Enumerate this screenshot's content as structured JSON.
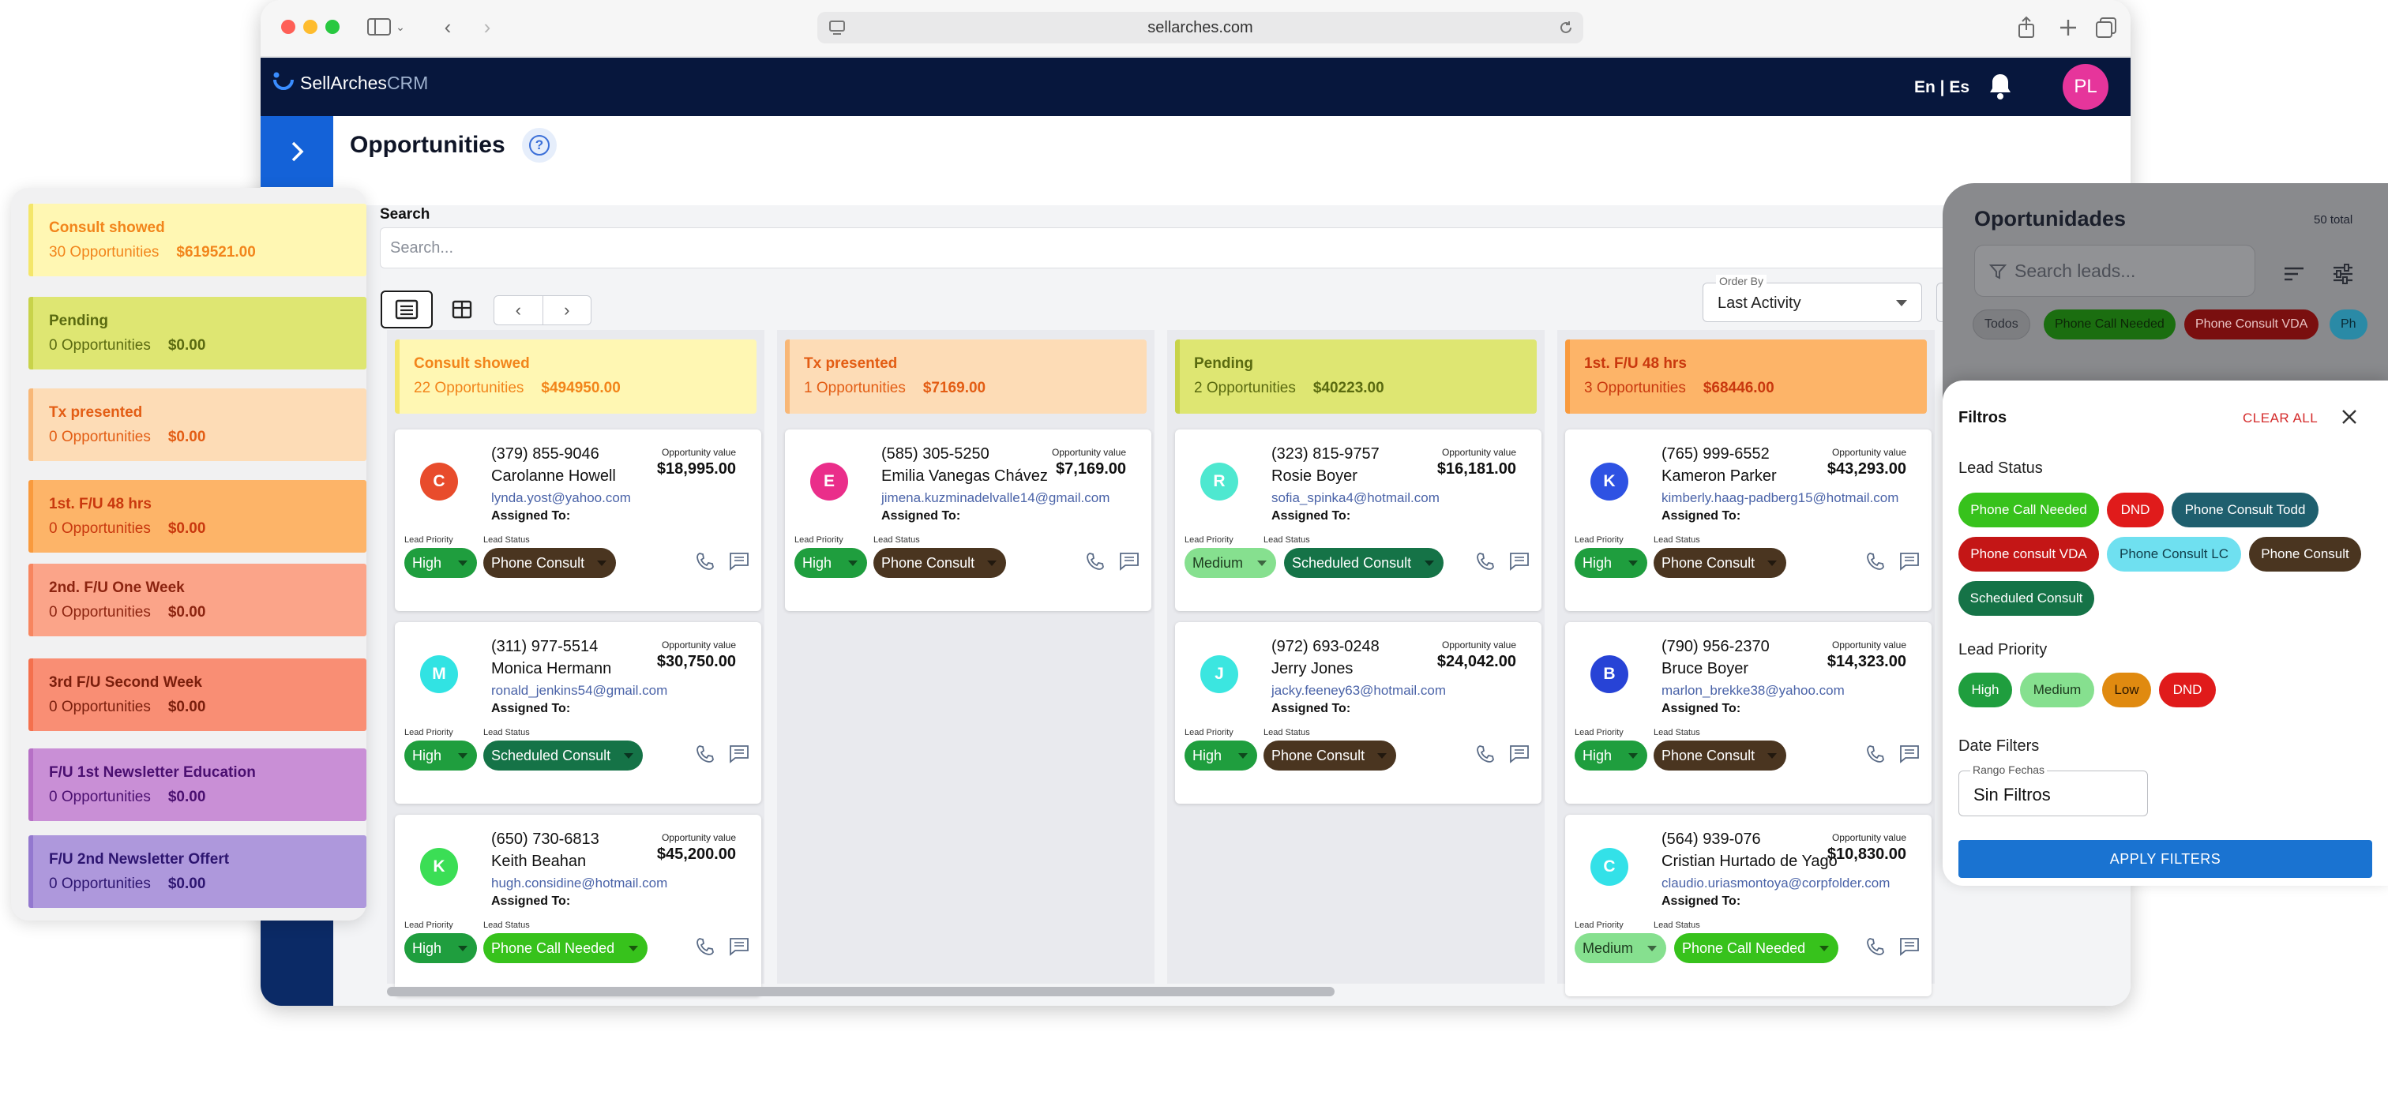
{
  "browser": {
    "url": "sellarches.com"
  },
  "app": {
    "brand": "SellArches",
    "brand_suffix": "CRM",
    "language": "En | Es",
    "avatar_initials": "PL",
    "page_title": "Opportunities"
  },
  "search": {
    "label": "Search",
    "placeholder": "Search..."
  },
  "order_by": {
    "label": "Order By",
    "value": "Last Activity"
  },
  "columns": [
    {
      "title": "Consult showed",
      "count": "22 Opportunities",
      "amount": "$494950.00",
      "cards": [
        {
          "initial": "C",
          "phone": "(379) 855-9046",
          "name": "Carolanne Howell",
          "email": "lynda.yost@yahoo.com",
          "assigned": "Assigned To:",
          "value_label": "Opportunity value",
          "value": "$18,995.00",
          "lp_label": "Lead Priority",
          "ls_label": "Lead Status",
          "priority": "High",
          "status": "Phone Consult"
        },
        {
          "initial": "M",
          "phone": "(311) 977-5514",
          "name": "Monica Hermann",
          "email": "ronald_jenkins54@gmail.com",
          "assigned": "Assigned To:",
          "value_label": "Opportunity value",
          "value": "$30,750.00",
          "lp_label": "Lead Priority",
          "ls_label": "Lead Status",
          "priority": "High",
          "status": "Scheduled Consult"
        },
        {
          "initial": "K",
          "phone": "(650) 730-6813",
          "name": "Keith Beahan",
          "email": "hugh.considine@hotmail.com",
          "assigned": "Assigned To:",
          "value_label": "Opportunity value",
          "value": "$45,200.00",
          "lp_label": "Lead Priority",
          "ls_label": "Lead Status",
          "priority": "High",
          "status": "Phone Call Needed"
        }
      ]
    },
    {
      "title": "Tx presented",
      "count": "1 Opportunities",
      "amount": "$7169.00",
      "cards": [
        {
          "initial": "E",
          "phone": "(585) 305-5250",
          "name": "Emilia Vanegas Chávez",
          "email": "jimena.kuzminadelvalle14@gmail.com",
          "assigned": "Assigned To:",
          "value_label": "Opportunity value",
          "value": "$7,169.00",
          "lp_label": "Lead Priority",
          "ls_label": "Lead Status",
          "priority": "High",
          "status": "Phone Consult"
        }
      ]
    },
    {
      "title": "Pending",
      "count": "2 Opportunities",
      "amount": "$40223.00",
      "cards": [
        {
          "initial": "R",
          "phone": "(323) 815-9757",
          "name": "Rosie Boyer",
          "email": "sofia_spinka4@hotmail.com",
          "assigned": "Assigned To:",
          "value_label": "Opportunity value",
          "value": "$16,181.00",
          "lp_label": "Lead Priority",
          "ls_label": "Lead Status",
          "priority": "Medium",
          "status": "Scheduled Consult"
        },
        {
          "initial": "J",
          "phone": "(972) 693-0248",
          "name": "Jerry Jones",
          "email": "jacky.feeney63@hotmail.com",
          "assigned": "Assigned To:",
          "value_label": "Opportunity value",
          "value": "$24,042.00",
          "lp_label": "Lead Priority",
          "ls_label": "Lead Status",
          "priority": "High",
          "status": "Phone Consult"
        }
      ]
    },
    {
      "title": "1st. F/U 48 hrs",
      "count": "3 Opportunities",
      "amount": "$68446.00",
      "cards": [
        {
          "initial": "K",
          "phone": "(765) 999-6552",
          "name": "Kameron Parker",
          "email": "kimberly.haag-padberg15@hotmail.com",
          "assigned": "Assigned To:",
          "value_label": "Opportunity value",
          "value": "$43,293.00",
          "lp_label": "Lead Priority",
          "ls_label": "Lead Status",
          "priority": "High",
          "status": "Phone Consult"
        },
        {
          "initial": "B",
          "phone": "(790) 956-2370",
          "name": "Bruce Boyer",
          "email": "marlon_brekke38@yahoo.com",
          "assigned": "Assigned To:",
          "value_label": "Opportunity value",
          "value": "$14,323.00",
          "lp_label": "Lead Priority",
          "ls_label": "Lead Status",
          "priority": "High",
          "status": "Phone Consult"
        },
        {
          "initial": "C",
          "phone": "(564) 939-076",
          "name": "Cristian Hurtado de Yago",
          "email": "claudio.uriasmontoya@corpfolder.com",
          "assigned": "Assigned To:",
          "value_label": "Opportunity value",
          "value": "$10,830.00",
          "lp_label": "Lead Priority",
          "ls_label": "Lead Status",
          "priority": "Medium",
          "status": "Phone Call Needed"
        }
      ]
    }
  ],
  "left_list": [
    {
      "title": "Consult showed",
      "count": "30 Opportunities",
      "amount": "$619521.00"
    },
    {
      "title": "Pending",
      "count": "0 Opportunities",
      "amount": "$0.00"
    },
    {
      "title": "Tx presented",
      "count": "0 Opportunities",
      "amount": "$0.00"
    },
    {
      "title": "1st. F/U 48 hrs",
      "count": "0 Opportunities",
      "amount": "$0.00"
    },
    {
      "title": "2nd. F/U One Week",
      "count": "0 Opportunities",
      "amount": "$0.00"
    },
    {
      "title": "3rd F/U Second Week",
      "count": "0 Opportunities",
      "amount": "$0.00"
    },
    {
      "title": "F/U 1st Newsletter Education",
      "count": "0 Opportunities",
      "amount": "$0.00"
    },
    {
      "title": "F/U 2nd Newsletter Offert",
      "count": "0 Opportunities",
      "amount": "$0.00"
    }
  ],
  "right_panel": {
    "title": "Oportunidades",
    "total": "50 total",
    "search_placeholder": "Search leads...",
    "chips": [
      "Todos",
      "Phone Call Needed",
      "Phone Consult VDA",
      "Ph"
    ]
  },
  "filters": {
    "title": "Filtros",
    "clear_all": "CLEAR ALL",
    "lead_status_label": "Lead Status",
    "lead_status": [
      "Phone Call Needed",
      "DND",
      "Phone Consult Todd",
      "Phone consult VDA",
      "Phone Consult LC",
      "Phone Consult",
      "Scheduled Consult"
    ],
    "lead_priority_label": "Lead Priority",
    "lead_priority": [
      "High",
      "Medium",
      "Low",
      "DND"
    ],
    "date_filters_label": "Date Filters",
    "date_range_label": "Rango Fechas",
    "date_range_value": "Sin Filtros",
    "apply": "APPLY FILTERS"
  },
  "colors": {
    "navbar": "#07173d",
    "accent_blue": "#1a73d1",
    "priority_high": "#1f9e3e",
    "priority_medium": "#86e08f",
    "status_phone_consult": "#4a3520",
    "status_scheduled_consult": "#157347",
    "status_phone_call_needed": "#37c21c"
  }
}
